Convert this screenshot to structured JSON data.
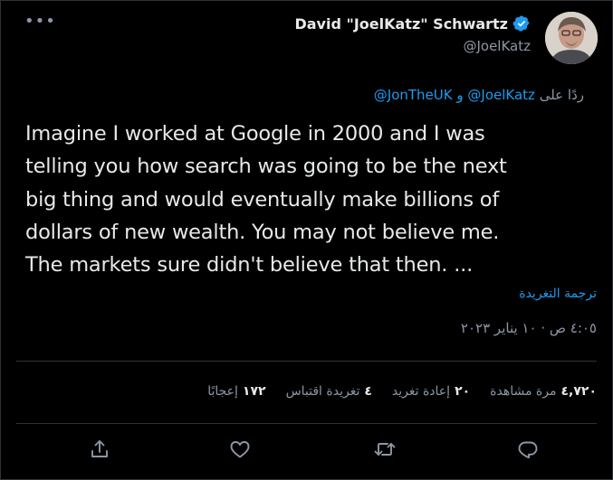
{
  "tweet": {
    "author": {
      "display_name": "David \"JoelKatz\" Schwartz",
      "handle": "@JoelKatz",
      "verified": true
    },
    "reply_to": {
      "prefix": "ردًا على",
      "mention_1": "@JoelKatz",
      "conjunction": "و",
      "mention_2": "@JonTheUK"
    },
    "text_lines": [
      "Imagine I worked at Google in 2000 and I was",
      "telling you how search was going to be the next",
      "big thing and would eventually make billions of",
      "dollars of new wealth. You may not believe me.",
      "The markets sure didn't believe that then. ..."
    ],
    "translate_label": "ترجمة التغريدة",
    "timestamp": "٤:٠٥ ص · ١٠ يناير ٢٠٢٣",
    "stats": {
      "views_count": "٤,٧٢٠",
      "views_label": "مرة مشاهدة",
      "retweets_count": "٢٠",
      "retweets_label": "إعادة تغريد",
      "quotes_count": "٤",
      "quotes_label": "تغريدة اقتباس",
      "likes_count": "١٧٢",
      "likes_label": "إعجابًا"
    }
  },
  "icons": {
    "more": "more-horizontal-icon",
    "verified": "verified-badge-icon",
    "reply": "reply-icon",
    "retweet": "retweet-icon",
    "like": "heart-icon",
    "share": "share-icon"
  },
  "colors": {
    "background": "#000000",
    "text_primary": "#e7e9ea",
    "text_secondary": "#8b98a5",
    "accent": "#1d9bf0",
    "divider": "#2f3336"
  }
}
